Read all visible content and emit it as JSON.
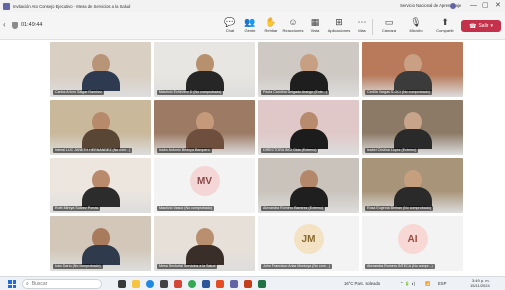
{
  "window": {
    "title": "Invitación Ato Consejo Ejecutivo · Mesa de Servicios a la Salud",
    "right_text": "Servicio Nacional de Aprendizaje",
    "controls": [
      "—",
      "▢",
      "✕"
    ]
  },
  "meeting": {
    "timer": "01:49:44",
    "tools": [
      {
        "label": "Chat",
        "icon": "chat-icon",
        "glyph": "💬"
      },
      {
        "label": "Gente",
        "icon": "people-icon",
        "glyph": "👥"
      },
      {
        "label": "Rehtiar",
        "icon": "raise-hand-icon",
        "glyph": "✋"
      },
      {
        "label": "Reacciones",
        "icon": "reactions-icon",
        "glyph": "☺"
      },
      {
        "label": "Vista",
        "icon": "view-icon",
        "glyph": "▦"
      },
      {
        "label": "Aplicaciones",
        "icon": "apps-icon",
        "glyph": "⊞"
      },
      {
        "label": "Más",
        "icon": "more-icon",
        "glyph": "⋯"
      },
      {
        "label": "Cámara",
        "icon": "camera-icon",
        "glyph": "▭"
      },
      {
        "label": "Micrófo",
        "icon": "microphone-icon",
        "glyph": "🎙"
      },
      {
        "label": "Compartir",
        "icon": "share-icon",
        "glyph": "⬆"
      }
    ],
    "leave_label": "Salir",
    "leave_color": "#c4314b"
  },
  "participants": [
    {
      "name": "Carlos Arturo Salgar Ramírez",
      "type": "video",
      "bg": "#d9cfc3",
      "skin": "#b89478",
      "shirt": "#2e3a4f"
    },
    {
      "name": "Mauricio Echevero D (No comprobado)",
      "type": "video",
      "bg": "#e8e6e2",
      "skin": "#b7906d",
      "shirt": "#262626"
    },
    {
      "name": "Paola Carolina Delgado Arango (Exte...)",
      "type": "video",
      "bg": "#cfc9c4",
      "skin": "#c79f82",
      "shirt": "#1e1e1e"
    },
    {
      "name": "Cecilia Vargas S-OCI (No comprobado)",
      "type": "video",
      "bg": "#b87a5a",
      "skin": "#caa084",
      "shirt": "#3b3b3b"
    },
    {
      "name": "Interal LUC JANETH HERNÁNDEZ (No com...)",
      "type": "video",
      "bg": "#c9b89a",
      "skin": "#b68a6a",
      "shirt": "#5a4635"
    },
    {
      "name": "Isidro Antonio Bedoya Barquero",
      "type": "video",
      "bg": "#9c7a64",
      "skin": "#c49a7b",
      "shirt": "#6e4e3c"
    },
    {
      "name": "DIRECTORA INCI Gida (Externo)",
      "type": "video",
      "bg": "#e0c8c8",
      "skin": "#b88a6e",
      "shirt": "#1c1c1c"
    },
    {
      "name": "Isabel Cristina Lopez (Externo)",
      "type": "video",
      "bg": "#8c7a66",
      "skin": "#c8a48a",
      "shirt": "#2a2a2a"
    },
    {
      "name": "Ruth Mireya Suarez Porras",
      "type": "video",
      "bg": "#ece6df",
      "skin": "#b98a6c",
      "shirt": "#2c2c2c"
    },
    {
      "name": "Mauricio Vasco (No comprobado)",
      "type": "avatar",
      "initials": "MV",
      "circle": "#f4d6d6",
      "ink": "#8a4747"
    },
    {
      "name": "Alexandra Romero Ramírez (Externo)",
      "type": "video",
      "bg": "#c9c3bb",
      "skin": "#b3876a",
      "shirt": "#1f1f1f"
    },
    {
      "name": "Rosa Eugenia Beltran (No comprobado)",
      "type": "video",
      "bg": "#a89478",
      "skin": "#c69f7f",
      "shirt": "#2a2a2a"
    },
    {
      "name": "Iván Darío (No comprobado)",
      "type": "video",
      "bg": "#d2c7b8",
      "skin": "#a87b5d",
      "shirt": "#2f3b4d"
    },
    {
      "name": "Mesa Sectorial Servicios a la Salud",
      "type": "video",
      "bg": "#e6e0d8",
      "skin": "#b8906f",
      "shirt": "#3a2e28"
    },
    {
      "name": "John Francisco Arias Montoya (No com...)",
      "type": "avatar",
      "initials": "JM",
      "circle": "#f3e2c4",
      "ink": "#8a6a2c"
    },
    {
      "name": "Alexandra Romero INTECA (No compr...)",
      "type": "avatar",
      "initials": "AI",
      "circle": "#f8d8d4",
      "ink": "#9a4a40"
    }
  ],
  "taskbar": {
    "search_placeholder": "Buscar",
    "weather": "16°C  Parc. soleado",
    "language": "ESP",
    "time": "3:49 p. m.",
    "date": "15/11/2024"
  }
}
